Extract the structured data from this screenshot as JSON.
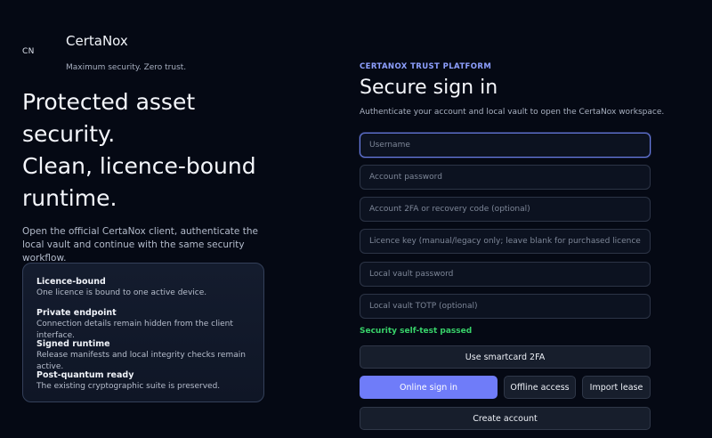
{
  "brand": {
    "mark": "CN",
    "name": "CertaNox",
    "tagline": "Maximum security. Zero trust."
  },
  "hero": {
    "line1": "Protected asset",
    "line2": "security.",
    "line3": "Clean, licence-bound",
    "line4": "runtime.",
    "description": "Open the official CertaNox client, authenticate the local vault and continue with the same security workflow."
  },
  "features": [
    {
      "title": "Licence-bound",
      "desc": "One licence is bound to one active device."
    },
    {
      "title": "Private endpoint",
      "desc": "Connection details remain hidden from the client interface."
    },
    {
      "title": "Signed runtime",
      "desc": "Release manifests and local integrity checks remain active."
    },
    {
      "title": "Post-quantum ready",
      "desc": "The existing cryptographic suite is preserved."
    }
  ],
  "form": {
    "eyebrow": "CERTANOX TRUST PLATFORM",
    "title": "Secure sign in",
    "subtitle": "Authenticate your account and local vault to open the CertaNox workspace.",
    "username_placeholder": "Username",
    "password_placeholder": "Account password",
    "twofa_placeholder": "Account 2FA or recovery code (optional)",
    "licence_placeholder": "Licence key (manual/legacy only; leave blank for purchased licence)",
    "vault_password_placeholder": "Local vault password",
    "vault_totp_placeholder": "Local vault TOTP (optional)",
    "self_test_status": "Security self-test passed",
    "smartcard_label": "Use smartcard 2FA",
    "online_signin_label": "Online sign in",
    "offline_label": "Offline access",
    "import_label": "Import lease",
    "create_account_label": "Create account"
  },
  "colors": {
    "background": "#050914",
    "accent": "#6f7cf9",
    "eyebrow": "#8ea0ff",
    "success": "#38d36a"
  }
}
